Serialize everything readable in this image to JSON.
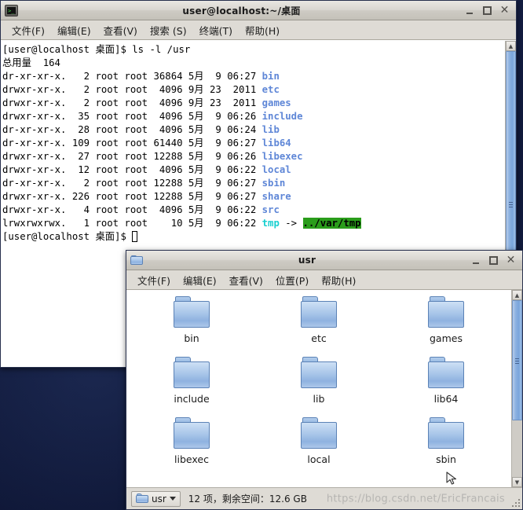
{
  "desktop": {
    "background_color": "#101a3a"
  },
  "terminal": {
    "icon": "terminal-icon",
    "title": "user@localhost:~/桌面",
    "controls": {
      "minimize": "_",
      "maximize": "□",
      "close": "✕"
    },
    "menu": [
      {
        "label": "文件(F)"
      },
      {
        "label": "编辑(E)"
      },
      {
        "label": "查看(V)"
      },
      {
        "label": "搜索 (S)"
      },
      {
        "label": "终端(T)"
      },
      {
        "label": "帮助(H)"
      }
    ],
    "prompt": "[user@localhost 桌面]$ ",
    "command": "ls -l /usr",
    "total_line": "总用量  164",
    "listing": [
      {
        "perms": "dr-xr-xr-x.",
        "links": "2",
        "owner": "root",
        "group": "root",
        "size": "36864",
        "month": "5月",
        "day": "9",
        "time": "06:27",
        "name": "bin",
        "type": "dir"
      },
      {
        "perms": "drwxr-xr-x.",
        "links": "2",
        "owner": "root",
        "group": "root",
        "size": "4096",
        "month": "9月",
        "day": "23",
        "time": "2011",
        "name": "etc",
        "type": "dir"
      },
      {
        "perms": "drwxr-xr-x.",
        "links": "2",
        "owner": "root",
        "group": "root",
        "size": "4096",
        "month": "9月",
        "day": "23",
        "time": "2011",
        "name": "games",
        "type": "dir"
      },
      {
        "perms": "drwxr-xr-x.",
        "links": "35",
        "owner": "root",
        "group": "root",
        "size": "4096",
        "month": "5月",
        "day": "9",
        "time": "06:26",
        "name": "include",
        "type": "dir"
      },
      {
        "perms": "dr-xr-xr-x.",
        "links": "28",
        "owner": "root",
        "group": "root",
        "size": "4096",
        "month": "5月",
        "day": "9",
        "time": "06:24",
        "name": "lib",
        "type": "dir"
      },
      {
        "perms": "dr-xr-xr-x.",
        "links": "109",
        "owner": "root",
        "group": "root",
        "size": "61440",
        "month": "5月",
        "day": "9",
        "time": "06:27",
        "name": "lib64",
        "type": "dir"
      },
      {
        "perms": "drwxr-xr-x.",
        "links": "27",
        "owner": "root",
        "group": "root",
        "size": "12288",
        "month": "5月",
        "day": "9",
        "time": "06:26",
        "name": "libexec",
        "type": "dir"
      },
      {
        "perms": "drwxr-xr-x.",
        "links": "12",
        "owner": "root",
        "group": "root",
        "size": "4096",
        "month": "5月",
        "day": "9",
        "time": "06:22",
        "name": "local",
        "type": "dir"
      },
      {
        "perms": "dr-xr-xr-x.",
        "links": "2",
        "owner": "root",
        "group": "root",
        "size": "12288",
        "month": "5月",
        "day": "9",
        "time": "06:27",
        "name": "sbin",
        "type": "dir"
      },
      {
        "perms": "drwxr-xr-x.",
        "links": "226",
        "owner": "root",
        "group": "root",
        "size": "12288",
        "month": "5月",
        "day": "9",
        "time": "06:27",
        "name": "share",
        "type": "dir"
      },
      {
        "perms": "drwxr-xr-x.",
        "links": "4",
        "owner": "root",
        "group": "root",
        "size": "4096",
        "month": "5月",
        "day": "9",
        "time": "06:22",
        "name": "src",
        "type": "dir"
      },
      {
        "perms": "lrwxrwxrwx.",
        "links": "1",
        "owner": "root",
        "group": "root",
        "size": "10",
        "month": "5月",
        "day": "9",
        "time": "06:22",
        "name": "tmp",
        "type": "link",
        "arrow": " -> ",
        "target": "../var/tmp"
      }
    ],
    "colors": {
      "dir": "#5f87d7",
      "link": "#17cfcf",
      "link_target_bg": "#2a9d1b"
    }
  },
  "filemanager": {
    "icon": "folder-icon",
    "title": "usr",
    "controls": {
      "minimize": "_",
      "maximize": "□",
      "close": "✕"
    },
    "menu": [
      {
        "label": "文件(F)"
      },
      {
        "label": "编辑(E)"
      },
      {
        "label": "查看(V)"
      },
      {
        "label": "位置(P)"
      },
      {
        "label": "帮助(H)"
      }
    ],
    "items": [
      {
        "label": "bin"
      },
      {
        "label": "etc"
      },
      {
        "label": "games"
      },
      {
        "label": "include"
      },
      {
        "label": "lib"
      },
      {
        "label": "lib64"
      },
      {
        "label": "libexec"
      },
      {
        "label": "local"
      },
      {
        "label": "sbin"
      }
    ],
    "statusbar": {
      "path_button_label": "usr",
      "status_text": "12 项，剩余空间：12.6 GB",
      "watermark": "https://blog.csdn.net/EricFrancais"
    }
  }
}
